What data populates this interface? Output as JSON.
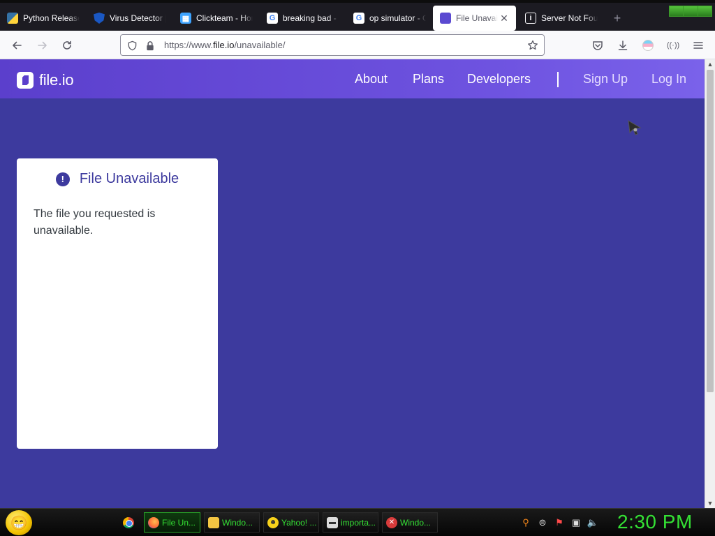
{
  "tabs": [
    {
      "title": "Python Releases for Windows",
      "favicon": "python-icon"
    },
    {
      "title": "Virus Detector | Scan",
      "favicon": "shield-icon"
    },
    {
      "title": "Clickteam - Home",
      "favicon": "clickteam-icon"
    },
    {
      "title": "breaking bad - Google",
      "favicon": "google-icon"
    },
    {
      "title": "op simulator - Google",
      "favicon": "google-icon"
    },
    {
      "title": "File Unavailable",
      "favicon": "fileio-icon",
      "active": true
    },
    {
      "title": "Server Not Found",
      "favicon": "info-icon"
    }
  ],
  "address": {
    "prefix": "https://www.",
    "host": "file.io",
    "path": "/unavailable/"
  },
  "site": {
    "logo": "file.io",
    "nav": {
      "about": "About",
      "plans": "Plans",
      "developers": "Developers",
      "sign_up": "Sign Up",
      "log_in": "Log In"
    }
  },
  "card": {
    "alert_glyph": "!",
    "title": "File Unavailable",
    "message": "The file you requested is unavailable."
  },
  "taskbar": {
    "items": [
      {
        "label": "File Un...",
        "icon": "firefox-icon"
      },
      {
        "label": "Windo...",
        "icon": "folder-icon"
      },
      {
        "label": "Yahoo! ...",
        "icon": "yahoo-smiley-icon"
      },
      {
        "label": "importa...",
        "icon": "file-icon"
      },
      {
        "label": "Windo...",
        "icon": "error-icon"
      }
    ],
    "clock": "2:30 PM"
  },
  "colors": {
    "page_bg": "#3d3a9e",
    "header_gradient_start": "#5b3fcc",
    "header_gradient_end": "#7a62ea",
    "taskbar_text": "#34e034"
  }
}
